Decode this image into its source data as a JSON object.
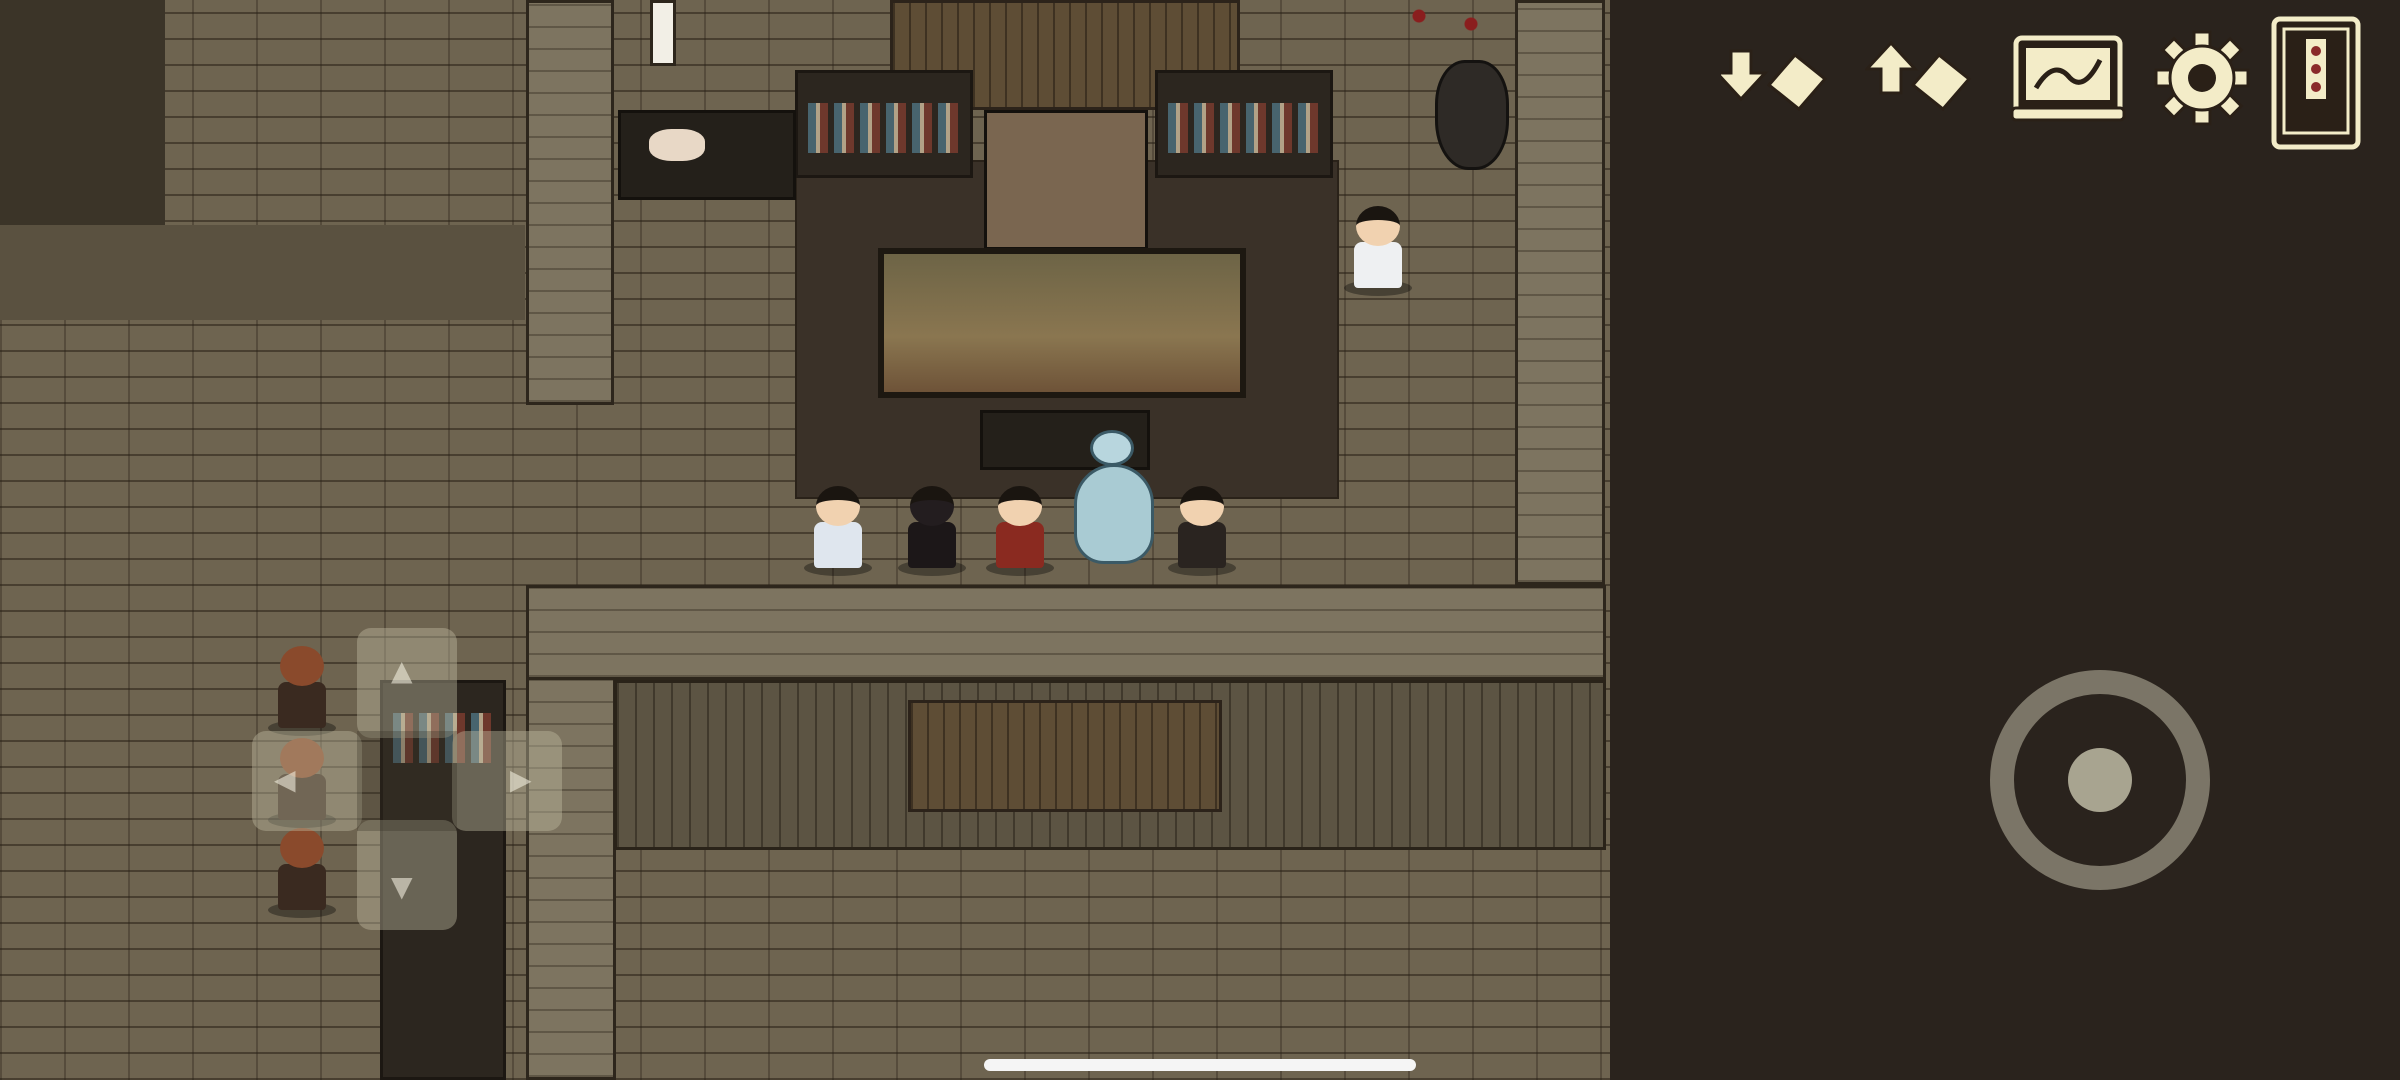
{
  "hud": {
    "icons": [
      "save-download-icon",
      "load-upload-icon",
      "map-scroll-icon",
      "settings-gear-icon",
      "card-deck-icon"
    ],
    "accent_color": "#f3ecc8",
    "outline_color": "#2a2017"
  },
  "controls": {
    "dpad_icons": [
      "arrow-up-icon",
      "arrow-down-icon",
      "arrow-left-icon",
      "arrow-right-icon"
    ],
    "dpad_glyphs": {
      "up": "▲",
      "down": "▼",
      "left": "◀",
      "right": "▶"
    },
    "joystick": "virtual-joystick"
  },
  "scene": {
    "floor_color": "#6e6450",
    "void_color": "#2a231d",
    "party_members": [
      "swordsman",
      "masked-ninja",
      "red-armored-general",
      "white-serpent",
      "young-martial-artist"
    ],
    "npcs": [
      "white-robed-lady",
      "bald-monk",
      "bald-monk",
      "bald-monk"
    ]
  }
}
